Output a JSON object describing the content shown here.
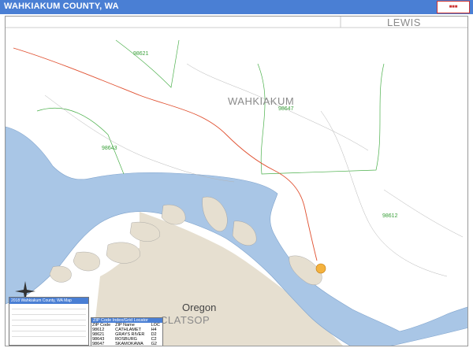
{
  "header": {
    "title": "WAHKIAKUM COUNTY, WA"
  },
  "colors": {
    "title_bar": "#4a7fd4",
    "water": "#a9c6e6",
    "land_oregon": "#e6dfd0",
    "zip_boundary": "#4bb04b",
    "road": "#e05030"
  },
  "map": {
    "labels": {
      "lewis": "LEWIS",
      "wahkiakum": "WAHKIAKUM",
      "clatsop": "CLATSOP",
      "oregon": "Oregon",
      "zip_98621": "98621",
      "zip_98647": "98647",
      "zip_98643": "98643",
      "zip_98612": "98612"
    }
  },
  "legend": {
    "title": "2018 Wahkiakum County, WA Map"
  },
  "zip_locator": {
    "title": "ZIP Code Index/Grid Locator",
    "headers": [
      "ZIP Code",
      "ZIP Name",
      "LOC"
    ],
    "rows": [
      [
        "98612",
        "CATHLAMET",
        "H4"
      ],
      [
        "98621",
        "GRAYS RIVER",
        "D2"
      ],
      [
        "98643",
        "ROSBURG",
        "C2"
      ],
      [
        "98647",
        "SKAMOKAWA",
        "G2"
      ]
    ]
  }
}
